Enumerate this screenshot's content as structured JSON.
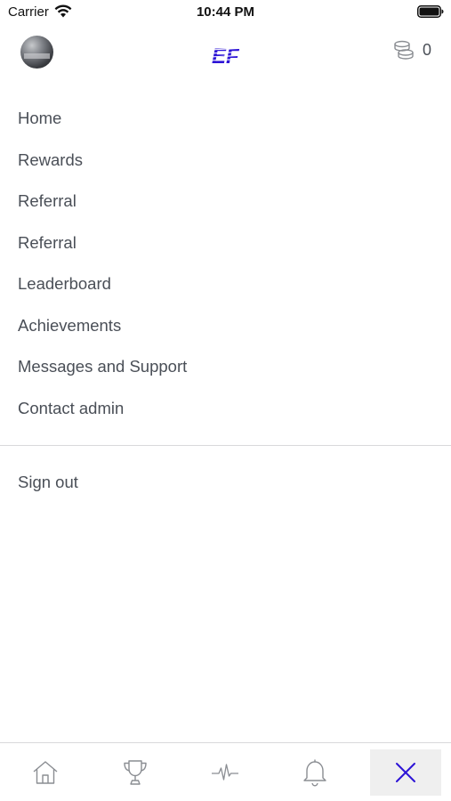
{
  "status_bar": {
    "carrier": "Carrier",
    "time": "10:44 PM"
  },
  "header": {
    "logo_text": "EF",
    "coins_count": "0",
    "accent_color": "#2d14d6"
  },
  "menu": {
    "items": [
      {
        "label": "Home"
      },
      {
        "label": "Rewards"
      },
      {
        "label": "Referral"
      },
      {
        "label": "Referral"
      },
      {
        "label": "Leaderboard"
      },
      {
        "label": "Achievements"
      },
      {
        "label": "Messages and Support"
      },
      {
        "label": "Contact admin"
      }
    ],
    "sign_out_label": "Sign out"
  },
  "tab_bar": {
    "tabs": [
      {
        "icon": "home-icon"
      },
      {
        "icon": "trophy-icon"
      },
      {
        "icon": "activity-icon"
      },
      {
        "icon": "bell-icon"
      },
      {
        "icon": "close-icon",
        "active": true
      }
    ]
  }
}
